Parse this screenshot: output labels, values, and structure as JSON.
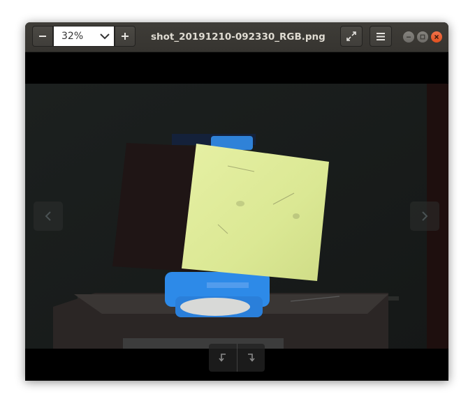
{
  "window": {
    "title": "shot_20191210-092330_RGB.png"
  },
  "zoom": {
    "value": "32%"
  },
  "icons": {
    "zoom_out": "minus-icon",
    "zoom_in": "plus-icon",
    "zoom_dropdown": "chevron-down-icon",
    "fullscreen": "fullscreen-icon",
    "menu": "hamburger-menu-icon",
    "minimize": "minimize-icon",
    "maximize": "maximize-icon",
    "close": "close-icon",
    "previous": "chevron-left-icon",
    "next": "chevron-right-icon",
    "rotate_left": "rotate-left-icon",
    "rotate_right": "rotate-right-icon"
  },
  "colors": {
    "headerbar": "#3c3b37",
    "close_button": "#e95420",
    "viewer_background": "#000000",
    "paper": "#e6f0a0",
    "blue_holder": "#2f8fe8"
  }
}
